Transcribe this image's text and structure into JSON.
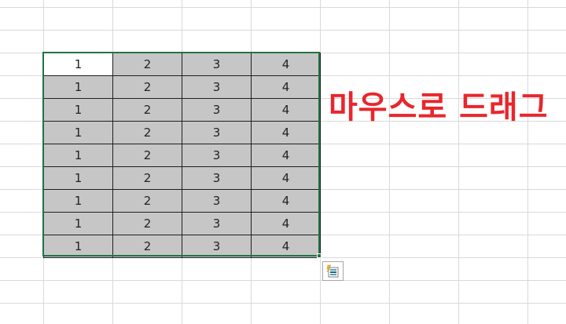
{
  "annotation": {
    "text": "마우스로 드래그",
    "color": "#e8262d"
  },
  "selection": {
    "border_color": "#217346",
    "fill_color": "#c6c6c6",
    "active_cell_fill": "#ffffff"
  },
  "table": {
    "rows": [
      [
        "1",
        "2",
        "3",
        "4"
      ],
      [
        "1",
        "2",
        "3",
        "4"
      ],
      [
        "1",
        "2",
        "3",
        "4"
      ],
      [
        "1",
        "2",
        "3",
        "4"
      ],
      [
        "1",
        "2",
        "3",
        "4"
      ],
      [
        "1",
        "2",
        "3",
        "4"
      ],
      [
        "1",
        "2",
        "3",
        "4"
      ],
      [
        "1",
        "2",
        "3",
        "4"
      ],
      [
        "1",
        "2",
        "3",
        "4"
      ]
    ]
  },
  "quick_analysis": {
    "icon": "quick-analysis-icon"
  }
}
